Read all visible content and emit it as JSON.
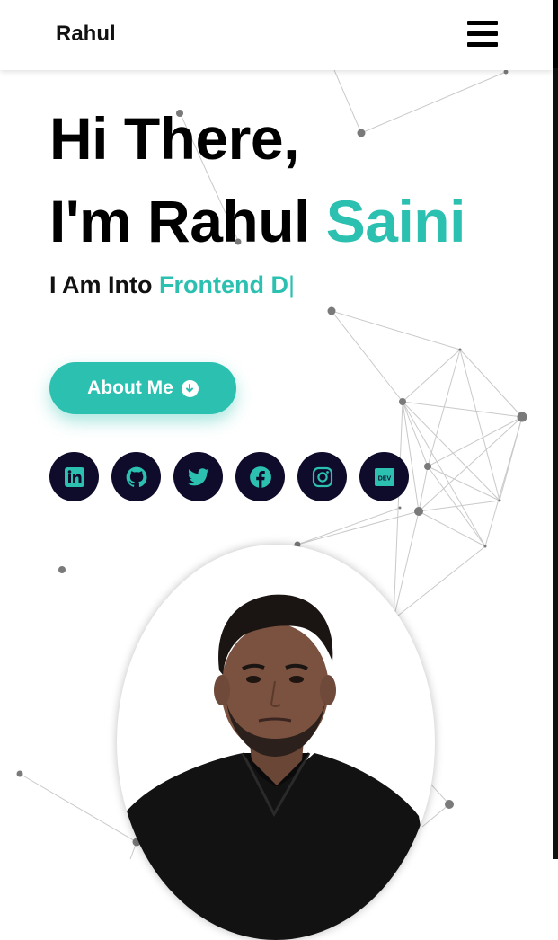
{
  "header": {
    "logo": "Rahul"
  },
  "hero": {
    "line1": "Hi There,",
    "line2_prefix": "I'm Rahul",
    "line2_accent": "Saini",
    "typed_prefix": "I Am Into",
    "typed_text": "Frontend D",
    "typed_cursor": "|"
  },
  "about_button": {
    "label": "About Me"
  },
  "socials": [
    {
      "name": "linkedin-icon"
    },
    {
      "name": "github-icon"
    },
    {
      "name": "twitter-icon"
    },
    {
      "name": "facebook-icon"
    },
    {
      "name": "instagram-icon"
    },
    {
      "name": "dev-icon",
      "label": "DEV"
    }
  ],
  "colors": {
    "accent": "#2bc0b0",
    "dark": "#0e0b2b",
    "text": "#000000"
  }
}
